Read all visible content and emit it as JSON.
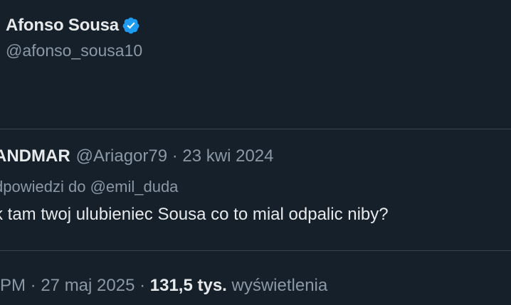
{
  "author": {
    "display_name": "Afonso Sousa",
    "handle": "@afonso_sousa10",
    "verified_icon": "verified-badge-icon",
    "verified_color": "#1d9bf0"
  },
  "quoted_tweet": {
    "name": "ANDMAR",
    "meta": "@Ariagor79 · 23 kwi 2024",
    "reply_prefix": "dpowiedzi do",
    "reply_mention": "@emil_duda",
    "text": "k tam twoj ulubieniec Sousa co to mial odpalic niby?"
  },
  "footer": {
    "time_date": "PM · 27 maj 2025 · ",
    "views_count": "131,5 tys.",
    "views_label": " wyświetlenia"
  },
  "colors": {
    "background": "#15202b",
    "primary_text": "#e7e9ea",
    "secondary_text": "#8b98a5",
    "divider": "#38444d"
  }
}
